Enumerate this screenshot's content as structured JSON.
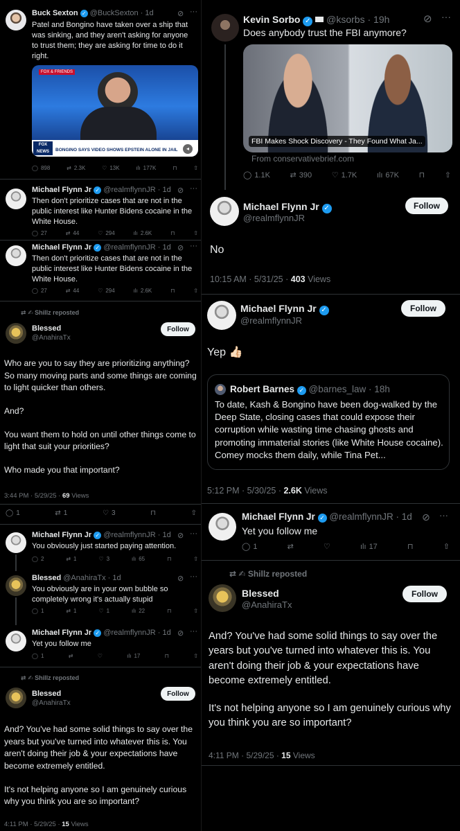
{
  "left": {
    "buck": {
      "name": "Buck Sexton",
      "handle": "@BuckSexton · 1d",
      "text": "Patel and Bongino have taken over a ship that was sinking, and they aren't asking for anyone to trust them; they are asking for time to do it right.",
      "media": {
        "top_tag": "FOX & FRIENDS",
        "logo": "FOX NEWS",
        "chyron": "BONGINO SAYS VIDEO SHOWS EPSTEIN ALONE IN JAIL"
      },
      "stats": {
        "replies": "898",
        "reposts": "2.3K",
        "likes": "13K",
        "views": "177K"
      }
    },
    "flynn1": {
      "name": "Michael Flynn Jr",
      "handle": "@realmflynnJR · 1d",
      "text": "Then don't prioritize cases that are not in the public interest like Hunter Bidens cocaine in the White House.",
      "stats": {
        "replies": "27",
        "reposts": "44",
        "likes": "294",
        "views": "2.6K"
      }
    },
    "flynn2": {
      "name": "Michael Flynn Jr",
      "handle": "@realmflynnJR · 1d",
      "text": "Then don't prioritize cases that are not in the public interest like Hunter Bidens cocaine in the White House.",
      "stats": {
        "replies": "27",
        "reposts": "44",
        "likes": "294",
        "views": "2.6K"
      }
    },
    "repost1": "Shillz reposted",
    "blessed1": {
      "name": "Blessed",
      "handle": "@AnahiraTx",
      "follow": "Follow",
      "p1": "Who are you to say they are prioritizing anything? So many moving parts and some things are coming to light quicker than others.",
      "p2": "And?",
      "p3": "You want them to hold on until other things come to light that suit your priorities?",
      "p4": "Who made you that important?",
      "time": "3:44 PM · 5/29/25 · ",
      "views": "69",
      "views_label": "Views",
      "stats": {
        "replies": "1",
        "reposts": "1",
        "likes": "3"
      }
    },
    "flynn3": {
      "name": "Michael Flynn Jr",
      "handle": "@realmflynnJR · 1d",
      "text": "You obviously just started paying attention.",
      "stats": {
        "replies": "2",
        "reposts": "1",
        "likes": "3",
        "views": "65"
      }
    },
    "blessed2": {
      "name": "Blessed",
      "handle": "@AnahiraTx · 1d",
      "text": "You obviously are in your own bubble so completely wrong it's actually stupid",
      "stats": {
        "replies": "1",
        "reposts": "1",
        "likes": "1",
        "views": "22"
      }
    },
    "flynn4": {
      "name": "Michael Flynn Jr",
      "handle": "@realmflynnJR · 1d",
      "text": "Yet you follow me",
      "stats": {
        "replies": "1",
        "reposts": "",
        "likes": "",
        "views": "17"
      }
    },
    "repost2": "Shillz reposted",
    "blessed3": {
      "name": "Blessed",
      "handle": "@AnahiraTx",
      "follow": "Follow",
      "p1": "And? You've had some solid things to say over the years but you've turned into whatever this is. You aren't doing their job & your expectations have become extremely entitled.",
      "p2": "It's not helping anyone so I am genuinely curious why you think you are so important?",
      "time": "4:11 PM · 5/29/25 · ",
      "views": "15",
      "views_label": "Views"
    }
  },
  "right": {
    "sorbo": {
      "name": "Kevin Sorbo",
      "handle": "@ksorbs · 19h",
      "text": "Does anybody trust the FBI anymore?",
      "media_caption": "FBI Makes Shock Discovery - They Found What Ja...",
      "link": "From conservativebrief.com",
      "stats": {
        "replies": "1.1K",
        "reposts": "390",
        "likes": "1.7K",
        "views": "67K"
      }
    },
    "flynnNo": {
      "name": "Michael Flynn Jr",
      "handle": "@realmflynnJR",
      "follow": "Follow",
      "text": "No",
      "time": "10:15 AM · 5/31/25 · ",
      "views": "403",
      "views_label": "Views"
    },
    "flynnYep": {
      "name": "Michael Flynn Jr",
      "handle": "@realmflynnJR",
      "follow": "Follow",
      "text": "Yep 👍🏻",
      "quote": {
        "name": "Robert Barnes",
        "handle": "@barnes_law · 18h",
        "text": "To date, Kash & Bongino have been dog-walked by the Deep State, closing cases that could expose their corruption while wasting time chasing ghosts and promoting immaterial stories (like White House cocaine). Comey mocks them daily, while Tina Pet..."
      },
      "time": "5:12 PM · 5/30/25 · ",
      "views": "2.6K",
      "views_label": "Views"
    },
    "flynnYet": {
      "name": "Michael Flynn Jr",
      "handle": "@realmflynnJR · 1d",
      "text": "Yet you follow me",
      "stats": {
        "replies": "1",
        "views": "17"
      }
    },
    "repost": "Shillz reposted",
    "blessed": {
      "name": "Blessed",
      "handle": "@AnahiraTx",
      "follow": "Follow",
      "p1": "And? You've had some solid things to say over the years but you've turned into whatever this is. You aren't doing their job & your expectations have become extremely entitled.",
      "p2": "It's not helping anyone so I am genuinely curious why you think you are so important?",
      "time": "4:11 PM · 5/29/25 · ",
      "views": "15",
      "views_label": "Views"
    }
  },
  "icons": {
    "reply": "reply-icon",
    "repost": "repost-icon",
    "like": "like-icon",
    "views": "views-icon",
    "bookmark": "bookmark-icon",
    "share": "share-icon",
    "grok": "grok-icon",
    "more": "more-icon"
  },
  "colors": {
    "background": "#000000",
    "text": "#e7e9ea",
    "muted": "#71767b",
    "verified": "#1d9bf0",
    "follow_bg": "#eff3f4",
    "divider": "#2f3336"
  }
}
